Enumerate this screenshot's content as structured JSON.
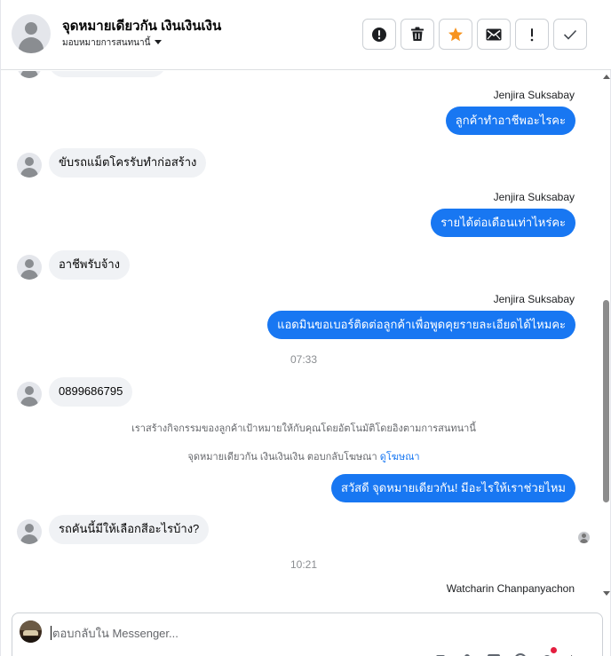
{
  "header": {
    "title": "จุดหมายเดียวกัน เงินเงินเงิน",
    "subtitle": "มอบหมายการสนทนานี้",
    "actions": [
      {
        "name": "spam-button",
        "icon": "alert-circle-icon"
      },
      {
        "name": "delete-button",
        "icon": "trash-icon"
      },
      {
        "name": "star-button",
        "icon": "star-icon"
      },
      {
        "name": "mark-unread-button",
        "icon": "envelope-icon"
      },
      {
        "name": "follow-up-button",
        "icon": "exclamation-icon"
      },
      {
        "name": "mark-done-button",
        "icon": "checkmark-icon"
      }
    ],
    "star_color": "#f7931e"
  },
  "messages": [
    {
      "type": "outgoing",
      "sender": "Jenjira Suksabay",
      "text": "ลูกค้าทำอาชีพอะไรคะ"
    },
    {
      "type": "incoming",
      "text": "ขับรถแม็ตโครรับทำก่อสร้าง"
    },
    {
      "type": "outgoing",
      "sender": "Jenjira Suksabay",
      "text": "รายได้ต่อเดือนเท่าไหร่คะ"
    },
    {
      "type": "incoming",
      "text": "อาชีพรับจ้าง"
    },
    {
      "type": "outgoing",
      "sender": "Jenjira Suksabay",
      "text": "แอดมินขอเบอร์ติดต่อลูกค้าเพื่อพูดคุยรายละเอียดได้ไหมคะ"
    },
    {
      "type": "timestamp",
      "text": "07:33"
    },
    {
      "type": "incoming",
      "text": "0899686795"
    },
    {
      "type": "system",
      "text": "เราสร้างกิจกรรมของลูกค้าเป้าหมายให้กับคุณโดยอัตโนมัติโดยอิงตามการสนทนานี้"
    },
    {
      "type": "system",
      "text": "จุดหมายเดียวกัน เงินเงินเงิน ตอบกลับโฆษณา",
      "link": "ดูโฆษณา"
    },
    {
      "type": "outgoing",
      "text": "สวัสดี จุดหมายเดียวกัน! มีอะไรให้เราช่วยไหม"
    },
    {
      "type": "incoming",
      "text": "รถคันนี้มีให้เลือกสีอะไรบ้าง?"
    },
    {
      "type": "timestamp",
      "text": "10:21"
    },
    {
      "type": "sender-only",
      "sender": "Watcharin Chanpanyachon"
    }
  ],
  "composer": {
    "placeholder": "ตอบกลับใน Messenger...",
    "value": "",
    "tools": [
      "thumbs-up-icon",
      "attachment-icon",
      "image-icon",
      "emoji-icon",
      "notification-icon",
      "send-icon"
    ]
  },
  "colors": {
    "accent": "#1877f2",
    "incoming_bubble": "#f0f2f5",
    "notification_dot": "#e41e3f"
  }
}
